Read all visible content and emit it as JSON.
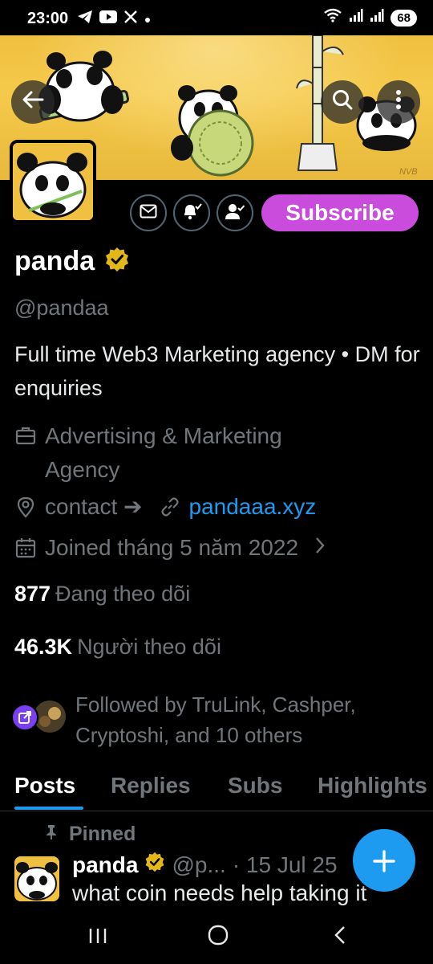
{
  "status_bar": {
    "time": "23:00",
    "battery": "68",
    "icons": [
      "telegram-icon",
      "youtube-icon",
      "x-icon",
      "dot-icon",
      "wifi-icon",
      "signal-icon",
      "signal-icon"
    ]
  },
  "header": {
    "back_icon": "arrow-left-icon",
    "search_icon": "search-icon",
    "more_icon": "more-vertical-icon",
    "banner_signature": "NVB"
  },
  "actions": {
    "message_icon": "mail-icon",
    "notify_icon": "bell-check-icon",
    "follow_icon": "person-check-icon",
    "subscribe_label": "Subscribe"
  },
  "profile": {
    "name": "panda",
    "verified_icon": "gold-verified-badge-icon",
    "handle": "@pandaa",
    "bio": "Full time Web3 Marketing agency • DM for enquiries",
    "category": "Advertising & Marketing Agency",
    "location": "contact ➔",
    "website": "pandaaa.xyz",
    "joined": "Joined tháng 5 năm 2022",
    "following_count": "877",
    "following_label": "Đang theo dõi",
    "followers_count": "46.3K",
    "followers_label": "Người theo dõi",
    "followed_by": "Followed by TruLink, Cashper, Cryptoshi, and 10 others"
  },
  "tabs": [
    {
      "label": "Posts",
      "active": true
    },
    {
      "label": "Replies",
      "active": false
    },
    {
      "label": "Subs",
      "active": false
    },
    {
      "label": "Highlights",
      "active": false
    }
  ],
  "pinned_post": {
    "pinned_label": "Pinned",
    "author": "panda",
    "handle": "@p...",
    "date": "· 15 Jul 25",
    "text": "what coin needs help taking it"
  },
  "fab": {
    "icon": "plus-icon"
  },
  "nav_bar": {
    "recent_icon": "recent-apps-icon",
    "home_icon": "home-circle-icon",
    "back_icon": "back-chevron-icon"
  },
  "colors": {
    "accent": "#1d9bf0",
    "subscribe": "#c94cdc",
    "banner": "#f0c040",
    "muted": "#71767b",
    "verified": "#e2b719"
  }
}
